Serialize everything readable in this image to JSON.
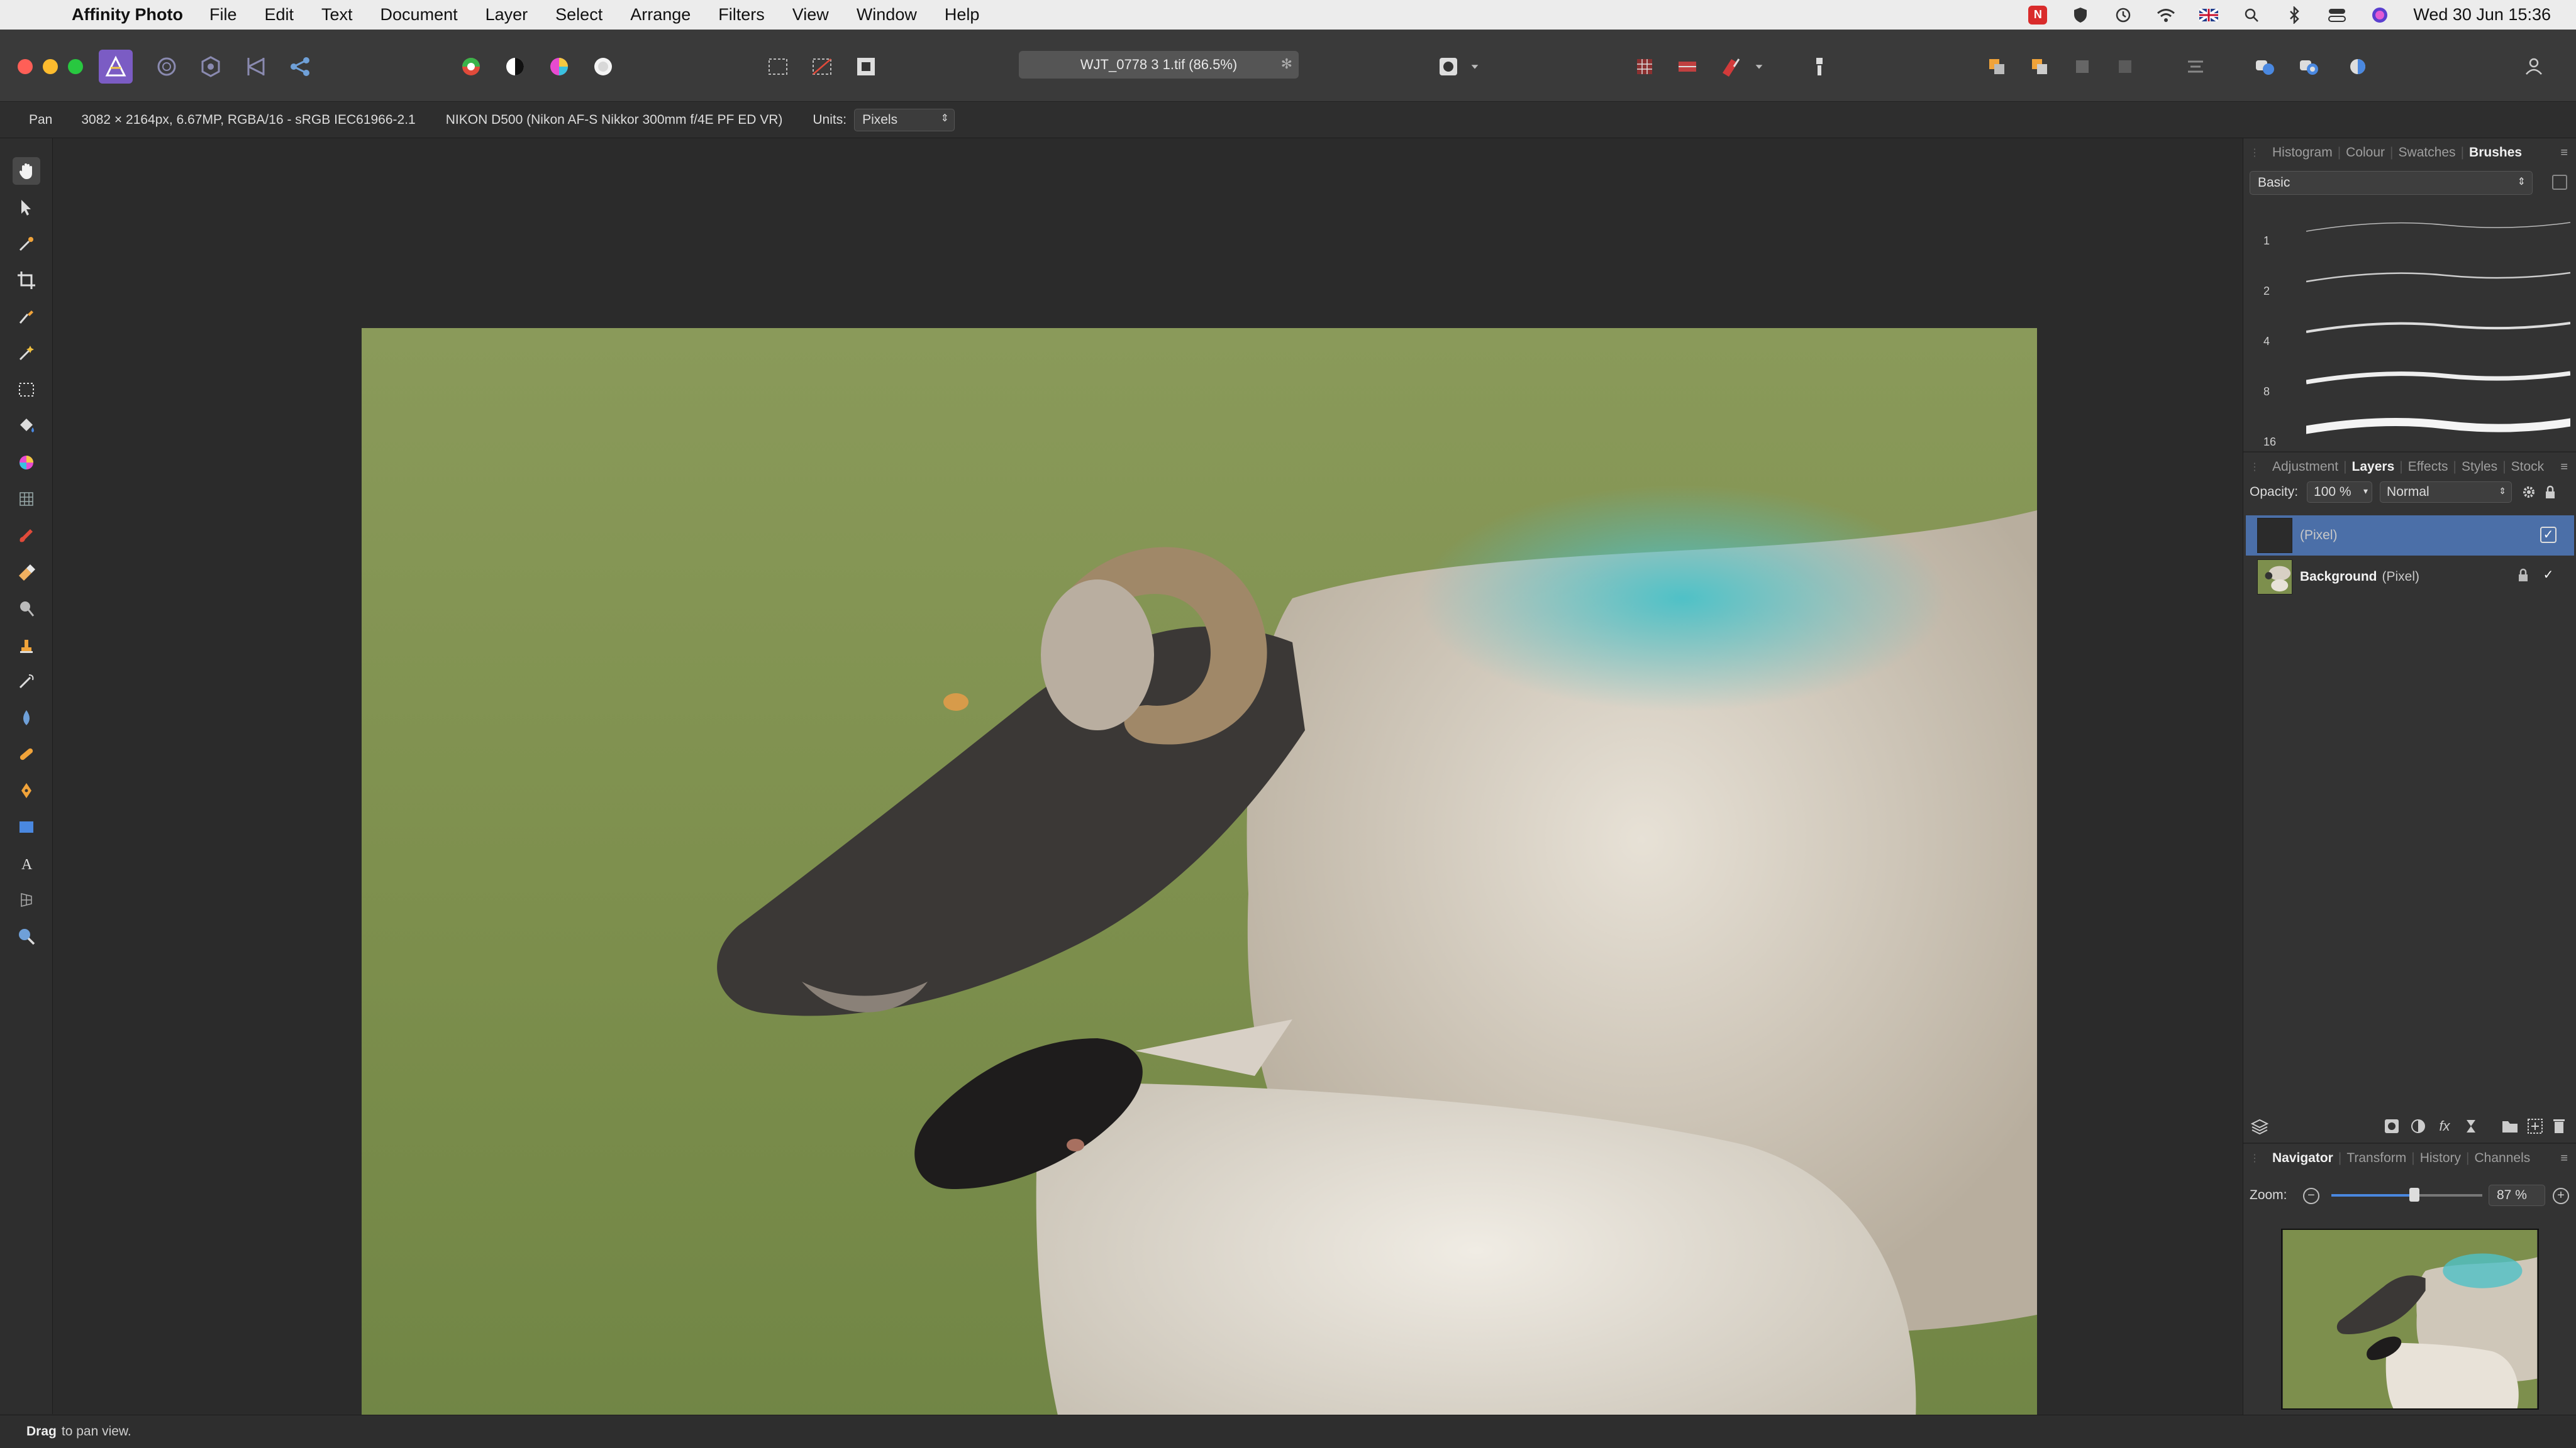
{
  "menubar": {
    "app_name": "Affinity Photo",
    "items": [
      "File",
      "Edit",
      "Text",
      "Document",
      "Layer",
      "Select",
      "Arrange",
      "Filters",
      "View",
      "Window",
      "Help"
    ],
    "clock": "Wed 30 Jun  15:36",
    "status_icons": [
      "app-alert-icon",
      "shield-icon",
      "time-machine-icon",
      "wifi-icon",
      "uk-flag-icon",
      "search-icon",
      "bluetooth-icon",
      "control-center-icon",
      "siri-icon"
    ]
  },
  "toolbar": {
    "document_tab": "WJT_0778 3 1.tif (86.5%)",
    "personas": [
      "photo-persona-icon",
      "liquify-persona-icon",
      "develop-persona-icon",
      "tone-mapping-persona-icon",
      "export-persona-icon"
    ]
  },
  "context": {
    "tool": "Pan",
    "doc_info": "3082 × 2164px, 6.67MP, RGBA/16 - sRGB IEC61966-2.1",
    "camera": "NIKON D500 (Nikon AF-S Nikkor 300mm f/4E PF ED VR)",
    "units_label": "Units:",
    "units_value": "Pixels"
  },
  "tools": [
    "hand-tool-icon",
    "move-tool-icon",
    "color-picker-icon",
    "crop-tool-icon",
    "selection-brush-icon",
    "flood-select-icon",
    "marquee-tool-icon",
    "flood-fill-icon",
    "gradient-tool-icon",
    "mesh-warp-icon",
    "paint-brush-icon",
    "erase-brush-icon",
    "dodge-tool-icon",
    "clone-tool-icon",
    "smudge-tool-icon",
    "blur-brush-icon",
    "healing-brush-icon",
    "pen-tool-icon",
    "rectangle-tool-icon",
    "text-tool-icon",
    "perspective-tool-icon",
    "zoom-tool-icon"
  ],
  "panels": {
    "top_tabs": [
      "Histogram",
      "Colour",
      "Swatches",
      "Brushes"
    ],
    "top_active": "Brushes",
    "brush_category": "Basic",
    "brush_sizes": [
      "1",
      "2",
      "4",
      "8",
      "16"
    ],
    "mid_tabs": [
      "Adjustment",
      "Layers",
      "Effects",
      "Styles",
      "Stock"
    ],
    "mid_active": "Layers",
    "opacity_label": "Opacity:",
    "opacity_value": "100 %",
    "blend_mode": "Normal",
    "layers": [
      {
        "name": "",
        "type": "(Pixel)",
        "selected": true,
        "visible": true,
        "locked": false
      },
      {
        "name": "Background",
        "type": "(Pixel)",
        "selected": false,
        "visible": true,
        "locked": true
      }
    ],
    "bottom_tabs": [
      "Navigator",
      "Transform",
      "History",
      "Channels"
    ],
    "bottom_active": "Navigator",
    "zoom_label": "Zoom:",
    "zoom_value": "87 %",
    "zoom_fraction": 0.55
  },
  "status": {
    "bold": "Drag",
    "text": "to pan view."
  },
  "colors": {
    "accent": "#4b6fa8",
    "panel_bg": "#333333",
    "canvas_bg": "#2b2b2b",
    "grass": "#7c8f4e",
    "wool_blue": "#4fc1c7"
  }
}
